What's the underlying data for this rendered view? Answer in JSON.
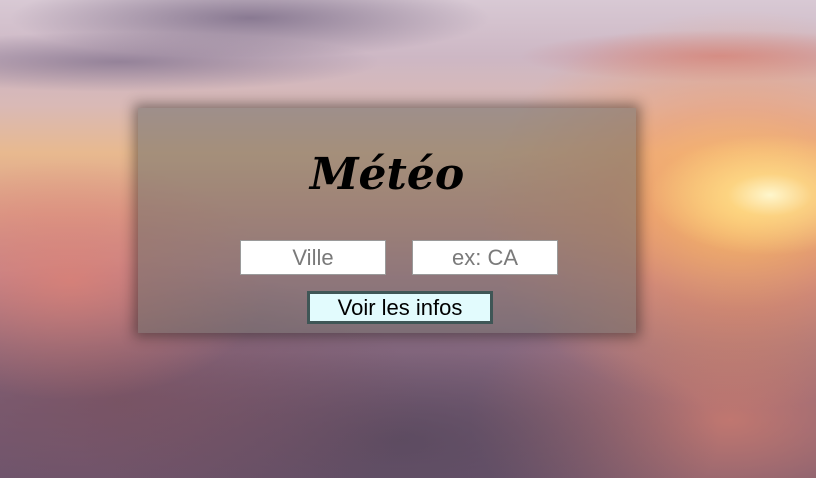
{
  "app": {
    "title": "Météo"
  },
  "form": {
    "city_placeholder": "Ville",
    "city_value": "",
    "country_placeholder": "ex: CA",
    "country_value": "",
    "submit_label": "Voir les infos"
  },
  "colors": {
    "card_overlay": "#6e6e69",
    "button_background": "#e2fbfd",
    "button_border": "#3f5656",
    "title_text": "#000000"
  }
}
